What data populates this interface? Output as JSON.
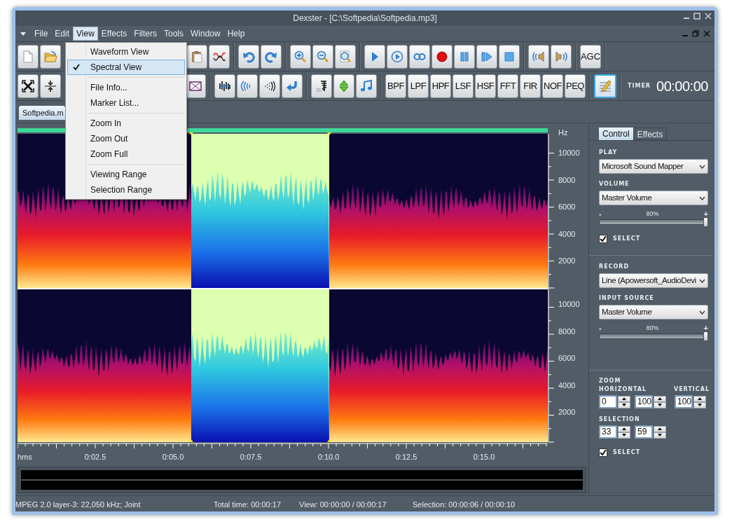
{
  "window": {
    "title": "Dexster - [C:\\Softpedia\\Softpedia.mp3]"
  },
  "menu_bar": [
    {
      "label": "File",
      "selected": false
    },
    {
      "label": "Edit",
      "selected": false
    },
    {
      "label": "View",
      "selected": true
    },
    {
      "label": "Effects",
      "selected": false
    },
    {
      "label": "Filters",
      "selected": false
    },
    {
      "label": "Tools",
      "selected": false
    },
    {
      "label": "Window",
      "selected": false
    },
    {
      "label": "Help",
      "selected": false
    }
  ],
  "view_menu": {
    "groups": [
      [
        {
          "label": "Waveform View",
          "checked": false,
          "selected": false
        },
        {
          "label": "Spectral View",
          "checked": true,
          "selected": true
        }
      ],
      [
        {
          "label": "File Info...",
          "checked": false,
          "selected": false
        },
        {
          "label": "Marker List...",
          "checked": false,
          "selected": false
        }
      ],
      [
        {
          "label": "Zoom In",
          "checked": false,
          "selected": false
        },
        {
          "label": "Zoom Out",
          "checked": false,
          "selected": false
        },
        {
          "label": "Zoom Full",
          "checked": false,
          "selected": false
        }
      ],
      [
        {
          "label": "Viewing Range",
          "checked": false,
          "selected": false
        },
        {
          "label": "Selection Range",
          "checked": false,
          "selected": false
        }
      ]
    ]
  },
  "toolbar_1": {
    "agc_button": "AGC"
  },
  "toolbar_2": {
    "filter_buttons": [
      "BPF",
      "LPF",
      "HPF",
      "LSF",
      "HSF",
      "FFT",
      "FIR",
      "NOF",
      "PEQ"
    ],
    "draw_tool_selected": true,
    "timer_label": "TIMER",
    "timer": "00:00:00"
  },
  "document_tab": {
    "label": "Softpedia.m",
    "selected": true
  },
  "spectrogram": {
    "unit": "Hz",
    "channel_1_ticks": [
      "10000",
      "8000",
      "6000",
      "4000",
      "2000"
    ],
    "channel_2_ticks": [
      "10000",
      "8000",
      "6000",
      "4000",
      "2000"
    ],
    "time_ticks": [
      "hms",
      "0:02.5",
      "0:05.0",
      "0:07.5",
      "0:10.0",
      "0:12.5",
      "0:15.0"
    ]
  },
  "right_panel": {
    "tabs": [
      {
        "label": "Control",
        "selected": true
      },
      {
        "label": "Effects",
        "selected": false
      }
    ],
    "play_section": {
      "heading": "PLAY",
      "device": "Microsoft Sound Mapper",
      "volume_heading": "VOLUME",
      "volume_source": "Master Volume",
      "minus": "-",
      "reading": "80%",
      "plus": "+",
      "level": 1.0,
      "select": {
        "label": "SELECT",
        "checked": true
      }
    },
    "record_section": {
      "heading": "RECORD",
      "device": "Line (Apowersoft_AudioDevi",
      "source_heading": "INPUT SOURCE",
      "source": "Master Volume",
      "minus": "-",
      "reading": "80%",
      "plus": "+",
      "level": 1.0
    },
    "zoom_section": {
      "heading": "ZOOM",
      "horizontal_label": "HORIZONTAL",
      "horizontal_from": "0",
      "horizontal_to": "100",
      "vertical_label": "VERTICAL",
      "vertical": "100",
      "selection_label": "SELECTION",
      "selection_from": "33",
      "selection_to": "59",
      "select": {
        "label": "SELECT",
        "checked": true
      }
    }
  },
  "status_bar": [
    "MPEG 2.0 layer-3: 22,050 kHz; Joint",
    "Total time: 00:00:17",
    "View: 00:00:00 / 00:00:17",
    "Selection: 00:00:06 / 00:00:10"
  ]
}
